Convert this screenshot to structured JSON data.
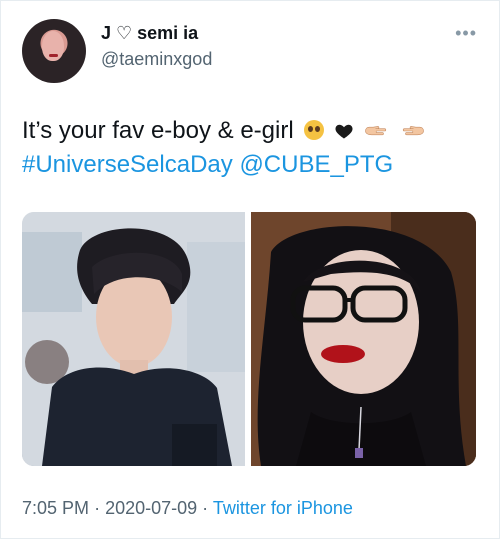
{
  "user": {
    "display_name": "J ♡ semi ia",
    "handle": "@taeminxgod"
  },
  "tweet": {
    "text": "It’s your fav e-boy & e-girl",
    "hashtag": "#UniverseSelcaDay",
    "mention": "@CUBE_PTG"
  },
  "meta": {
    "time": "7:05 PM",
    "separator": "·",
    "date": "2020-07-09",
    "source": "Twitter for iPhone"
  },
  "icons": {
    "menu": "more-horizontal-icon",
    "emoji": [
      "pleading-face",
      "black-heart",
      "pointing-hands"
    ]
  },
  "colors": {
    "link": "#1b95e0",
    "text": "#0f1419",
    "muted": "#536471"
  }
}
